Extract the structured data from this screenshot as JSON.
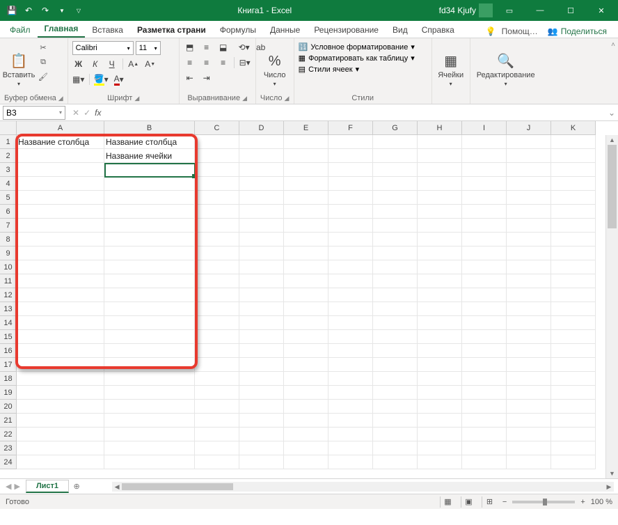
{
  "titlebar": {
    "doc_title": "Книга1 - Excel",
    "user": "fd34 Kjufy"
  },
  "tabs": {
    "file": "Файл",
    "home": "Главная",
    "insert": "Вставка",
    "layout": "Разметка страни",
    "formulas": "Формулы",
    "data": "Данные",
    "review": "Рецензирование",
    "view": "Вид",
    "help": "Справка",
    "tellme": "Помощ…",
    "share": "Поделиться"
  },
  "ribbon": {
    "clipboard": {
      "paste": "Вставить",
      "group": "Буфер обмена"
    },
    "font": {
      "name": "Calibri",
      "size": "11",
      "bold": "Ж",
      "italic": "К",
      "underline": "Ч",
      "group": "Шрифт"
    },
    "alignment": {
      "group": "Выравнивание"
    },
    "number": {
      "label": "Число",
      "group": "Число"
    },
    "styles": {
      "conditional": "Условное форматирование",
      "table": "Форматировать как таблицу",
      "cellstyles": "Стили ячеек",
      "group": "Стили"
    },
    "cells": {
      "label": "Ячейки",
      "group": ""
    },
    "editing": {
      "label": "Редактирование",
      "group": ""
    }
  },
  "namebox": "B3",
  "columns": [
    "A",
    "B",
    "C",
    "D",
    "E",
    "F",
    "G",
    "H",
    "I",
    "J",
    "K"
  ],
  "cells": {
    "A1": "Название столбца",
    "B1": "Название столбца",
    "B2": "Название ячейки"
  },
  "sheet": {
    "name": "Лист1"
  },
  "status": {
    "ready": "Готово",
    "zoom": "100 %"
  }
}
